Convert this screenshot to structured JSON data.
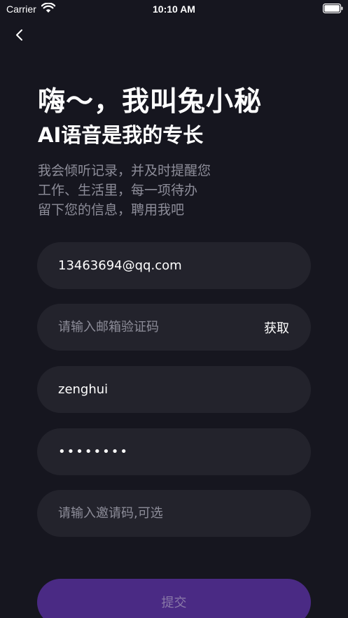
{
  "status_bar": {
    "carrier": "Carrier",
    "time": "10:10 AM"
  },
  "header": {
    "title": "嗨～，我叫兔小秘",
    "subtitle": "AI语音是我的专长",
    "description": [
      "我会倾听记录，并及时提醒您",
      "工作、生活里，每一项待办",
      "留下您的信息，聘用我吧"
    ]
  },
  "form": {
    "email": {
      "value": "13463694@qq.com",
      "placeholder": ""
    },
    "verify_code": {
      "value": "",
      "placeholder": "请输入邮箱验证码",
      "get_label": "获取"
    },
    "username": {
      "value": "zenghui",
      "placeholder": ""
    },
    "password": {
      "value": "12345678",
      "placeholder": ""
    },
    "invite_code": {
      "value": "",
      "placeholder": "请输入邀请码,可选"
    },
    "submit_label": "提交"
  },
  "colors": {
    "background": "#16161f",
    "field": "#23232c",
    "submit": "#4a2a84",
    "muted_text": "#8d8d99"
  }
}
